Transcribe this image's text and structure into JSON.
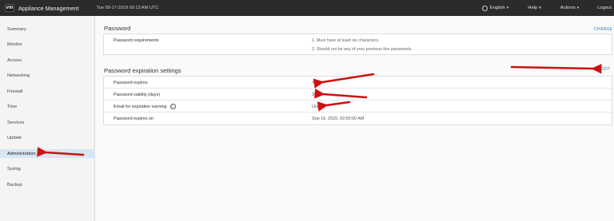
{
  "header": {
    "logo_text": "vm",
    "app_title": "Appliance Management",
    "datetime": "Tue 09-17-2019 09:13 AM UTC",
    "language": "English",
    "help": "Help",
    "actions": "Actions",
    "logout": "Logout",
    "caret": "▾"
  },
  "sidebar": {
    "items": [
      {
        "label": "Summary"
      },
      {
        "label": "Monitor"
      },
      {
        "label": "Access"
      },
      {
        "label": "Networking"
      },
      {
        "label": "Firewall"
      },
      {
        "label": "Time"
      },
      {
        "label": "Services"
      },
      {
        "label": "Update"
      },
      {
        "label": "Administration"
      },
      {
        "label": "Syslog"
      },
      {
        "label": "Backup"
      }
    ],
    "active_item": "Administration"
  },
  "password_section": {
    "title": "Password",
    "change_label": "CHANGE",
    "requirements_label": "Password requirements",
    "requirements": [
      "1. Must have at least six characters.",
      "2. Should not be any of your previous five passwords."
    ]
  },
  "expiration_section": {
    "title": "Password expiration settings",
    "edit_label": "EDIT",
    "rows": [
      {
        "label": "Password expires",
        "value": "Yes"
      },
      {
        "label": "Password validity (days)",
        "value": "365"
      },
      {
        "label": "Email for expiration warning",
        "value": "Unset",
        "info_icon": "i"
      },
      {
        "label": "Password expires on",
        "value": "Sep 16, 2020, 02:00:00 AM"
      }
    ]
  },
  "colors": {
    "header_bg": "#2b2b2b",
    "link": "#2a7ab8",
    "active_nav_bg": "#d7e6f2",
    "annotation_arrow": "#cc1111"
  }
}
